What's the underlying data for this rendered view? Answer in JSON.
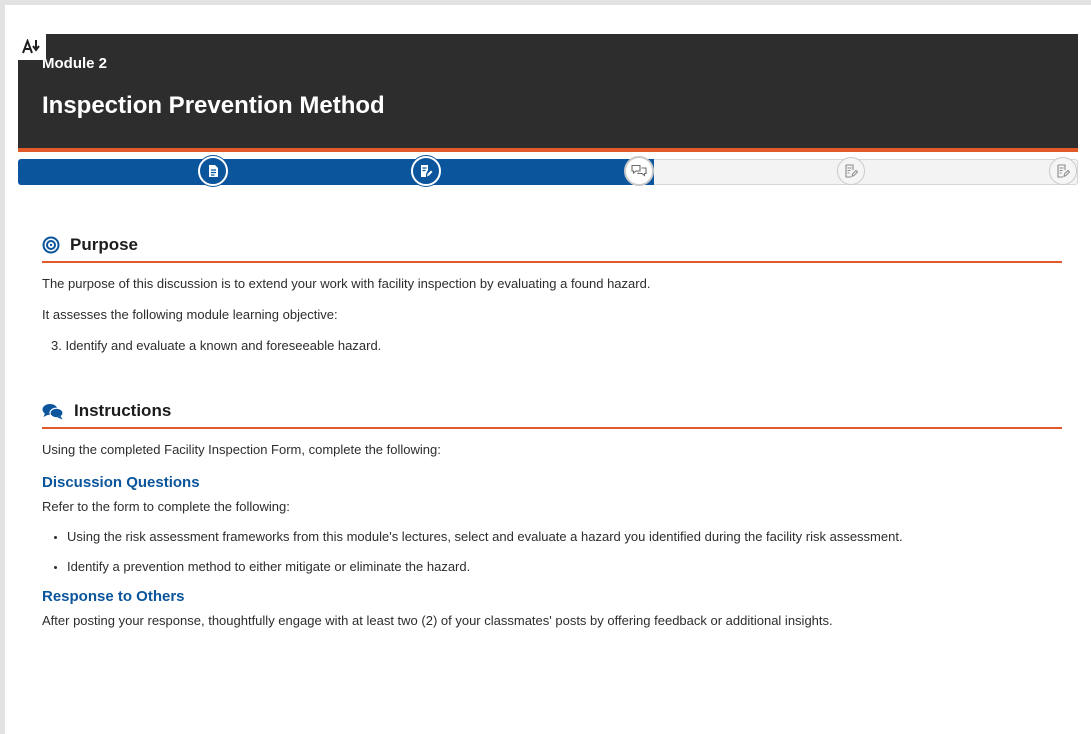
{
  "header": {
    "translate_icon": "font-size-icon",
    "module_label": "Module 2",
    "title": "Inspection Prevention Method"
  },
  "progress": {
    "completed_fraction": 0.6,
    "steps": [
      {
        "icon": "document-icon",
        "state": "done"
      },
      {
        "icon": "edit-document-icon",
        "state": "done"
      },
      {
        "icon": "discussion-icon",
        "state": "current"
      },
      {
        "icon": "edit-document-icon",
        "state": "todo"
      },
      {
        "icon": "edit-document-icon",
        "state": "todo"
      }
    ]
  },
  "purpose": {
    "icon": "target-icon",
    "heading": "Purpose",
    "paragraph1": "The purpose of this discussion is to extend your work with facility inspection by evaluating a found hazard.",
    "paragraph2": "It assesses the following module learning objective:",
    "objective": "3. Identify and evaluate a known and foreseeable hazard."
  },
  "instructions": {
    "icon": "comments-icon",
    "heading": "Instructions",
    "intro": "Using the completed Facility Inspection Form, complete the following:",
    "discussion_heading": "Discussion Questions",
    "discussion_intro": "Refer to the form to complete the following:",
    "bullets": [
      "Using the risk assessment frameworks from this module's lectures, select and evaluate a hazard you identified during the facility risk assessment.",
      "Identify a prevention method to either mitigate or eliminate the hazard."
    ],
    "response_heading": "Response to Others",
    "response_text": "After posting your response, thoughtfully engage with at least two (2) of your classmates' posts by offering feedback or additional insights."
  },
  "colors": {
    "banner": "#2d2d2d",
    "accent_orange": "#e15a2a",
    "brand_blue": "#0b559c"
  }
}
